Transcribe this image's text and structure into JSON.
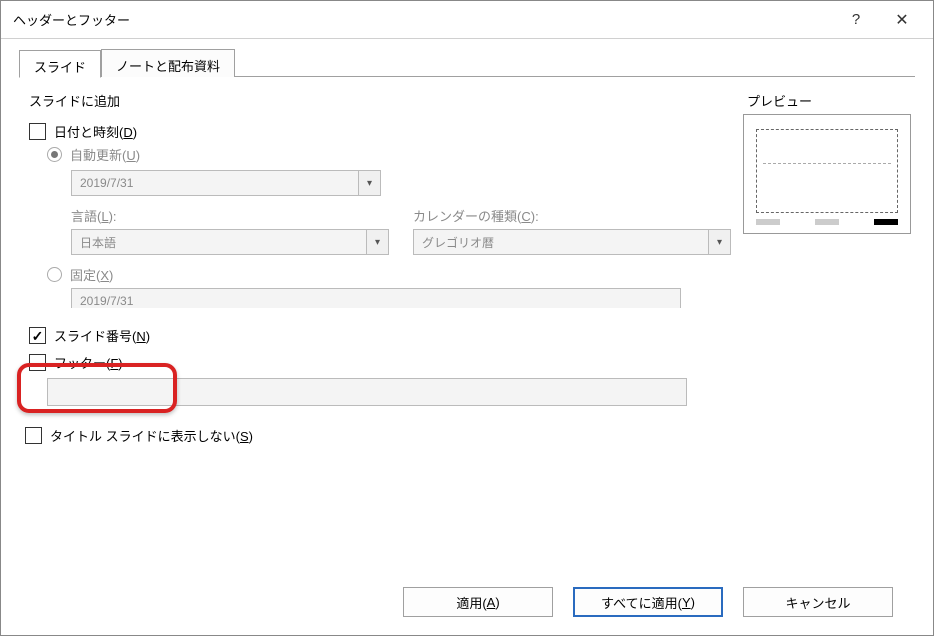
{
  "titlebar": {
    "title": "ヘッダーとフッター"
  },
  "tabs": {
    "slide": "スライド",
    "notes": "ノートと配布資料"
  },
  "group_add": {
    "legend": "スライドに追加"
  },
  "datetime": {
    "label_pre": "日付と時刻(",
    "accel": "D",
    "label_post": ")",
    "auto_pre": "自動更新(",
    "auto_accel": "U",
    "auto_post": ")",
    "auto_value": "2019/7/31",
    "lang_label_pre": "言語(",
    "lang_accel": "L",
    "lang_label_post": "):",
    "lang_value": "日本語",
    "cal_label_pre": "カレンダーの種類(",
    "cal_accel": "C",
    "cal_label_post": "):",
    "cal_value": "グレゴリオ暦",
    "fixed_pre": "固定(",
    "fixed_accel": "X",
    "fixed_post": ")",
    "fixed_value": "2019/7/31"
  },
  "slidenum": {
    "pre": "スライド番号(",
    "accel": "N",
    "post": ")"
  },
  "footerfld": {
    "pre": "フッター(",
    "accel": "F",
    "post": ")"
  },
  "titleslide": {
    "pre": "タイトル スライドに表示しない(",
    "accel": "S",
    "post": ")"
  },
  "preview": {
    "legend": "プレビュー"
  },
  "buttons": {
    "apply_pre": "適用(",
    "apply_accel": "A",
    "apply_post": ")",
    "applyall_pre": "すべてに適用(",
    "applyall_accel": "Y",
    "applyall_post": ")",
    "cancel": "キャンセル"
  }
}
